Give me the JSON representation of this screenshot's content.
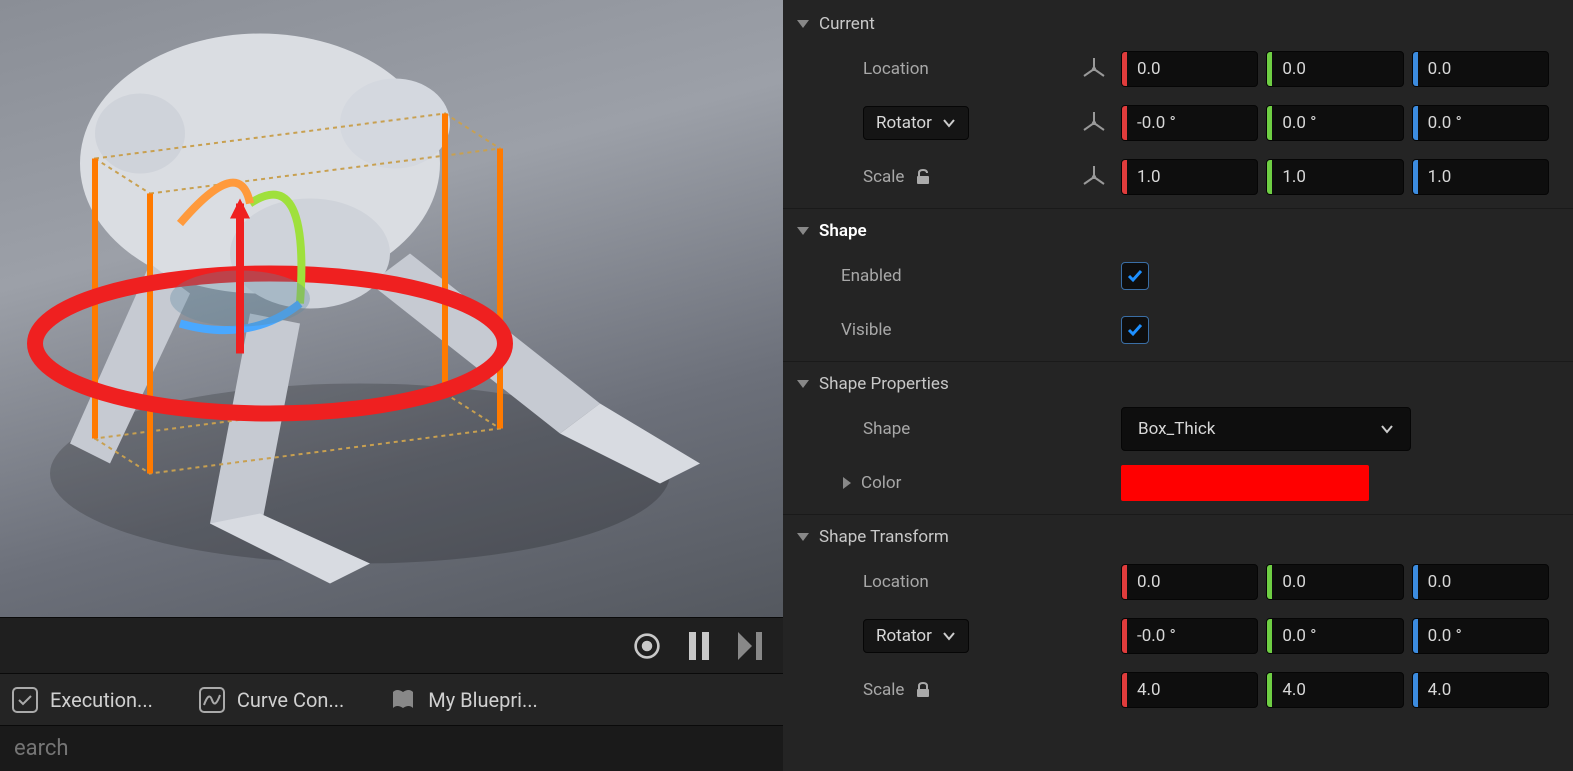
{
  "tabs": {
    "execution": "Execution...",
    "curve": "Curve Con...",
    "blueprint": "My Bluepri..."
  },
  "search": {
    "placeholder": "earch"
  },
  "panel": {
    "current": {
      "header": "Current",
      "location_label": "Location",
      "rotator_label": "Rotator",
      "scale_label": "Scale",
      "location": {
        "x": "0.0",
        "y": "0.0",
        "z": "0.0"
      },
      "rotator": {
        "x": "-0.0 °",
        "y": "0.0 °",
        "z": "0.0 °"
      },
      "scale": {
        "x": "1.0",
        "y": "1.0",
        "z": "1.0"
      }
    },
    "shape": {
      "header": "Shape",
      "enabled_label": "Enabled",
      "visible_label": "Visible",
      "enabled": true,
      "visible": true
    },
    "shape_props": {
      "header": "Shape Properties",
      "shape_label": "Shape",
      "shape_value": "Box_Thick",
      "color_label": "Color",
      "color_value": "#ff0000"
    },
    "shape_transform": {
      "header": "Shape Transform",
      "location_label": "Location",
      "rotator_label": "Rotator",
      "scale_label": "Scale",
      "location": {
        "x": "0.0",
        "y": "0.0",
        "z": "0.0"
      },
      "rotator": {
        "x": "-0.0 °",
        "y": "0.0 °",
        "z": "0.0 °"
      },
      "scale": {
        "x": "4.0",
        "y": "4.0",
        "z": "4.0"
      }
    }
  }
}
